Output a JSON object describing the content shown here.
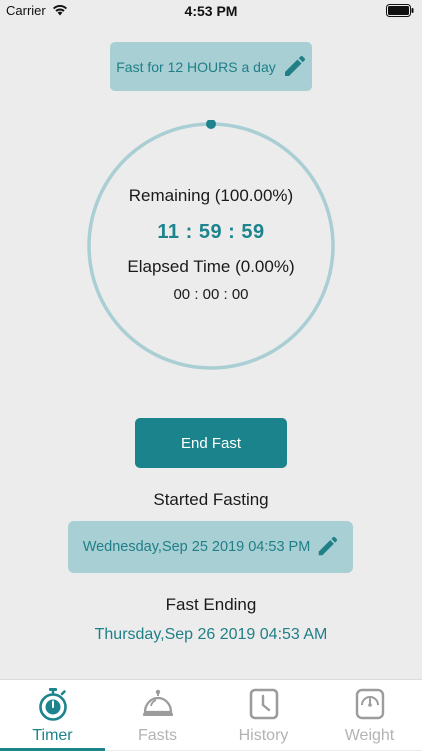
{
  "status_bar": {
    "carrier": "Carrier",
    "time": "4:53 PM"
  },
  "fast_goal": {
    "label": "Fast for 12 HOURS a day",
    "icon": "pencil-icon"
  },
  "timer": {
    "remaining_label": "Remaining (100.00%)",
    "remaining_time": "11 : 59 : 59",
    "elapsed_label": "Elapsed Time (0.00%)",
    "elapsed_time": "00 : 00 : 00",
    "elapsed_fraction": 0.0
  },
  "end_fast_button": "End Fast",
  "started": {
    "label": "Started Fasting",
    "date": "Wednesday,Sep 25 2019 04:53 PM",
    "icon": "pencil-icon"
  },
  "ending": {
    "label": "Fast Ending",
    "date": "Thursday,Sep 26 2019 04:53 AM"
  },
  "tabs": [
    {
      "label": "Timer",
      "icon": "stopwatch-icon",
      "active": true
    },
    {
      "label": "Fasts",
      "icon": "food-cloche-icon",
      "active": false
    },
    {
      "label": "History",
      "icon": "clock-icon",
      "active": false
    },
    {
      "label": "Weight",
      "icon": "scale-icon",
      "active": false
    }
  ],
  "colors": {
    "accent": "#1d838c",
    "accent_light": "#a7cfd4",
    "background": "#ececec",
    "ring": "#a9ced3",
    "tab_inactive": "#b3b3b3"
  }
}
